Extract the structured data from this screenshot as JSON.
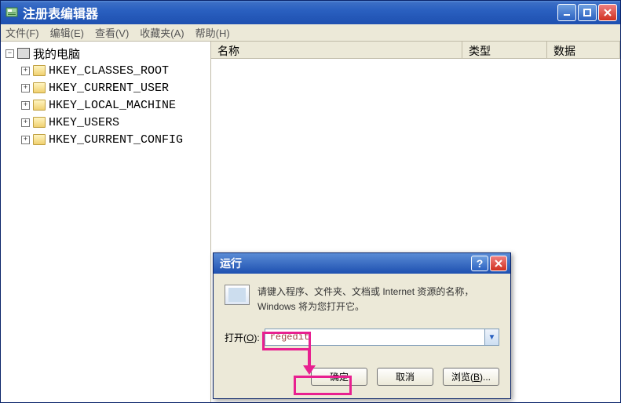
{
  "window": {
    "title": "注册表编辑器",
    "menu": {
      "file": "文件(F)",
      "edit": "编辑(E)",
      "view": "查看(V)",
      "favorites": "收藏夹(A)",
      "help": "帮助(H)"
    }
  },
  "tree": {
    "root_label": "我的电脑",
    "items": [
      "HKEY_CLASSES_ROOT",
      "HKEY_CURRENT_USER",
      "HKEY_LOCAL_MACHINE",
      "HKEY_USERS",
      "HKEY_CURRENT_CONFIG"
    ]
  },
  "list": {
    "columns": {
      "name": "名称",
      "type": "类型",
      "data": "数据"
    }
  },
  "run_dialog": {
    "title": "运行",
    "description": "请键入程序、文件夹、文档或 Internet 资源的名称，Windows 将为您打开它。",
    "open_label": "打开(O):",
    "open_value": "regedit",
    "ok": "确定",
    "cancel": "取消",
    "browse": "浏览(B)..."
  },
  "colors": {
    "highlight": "#e82090",
    "titlebar": "#2a60c0"
  }
}
